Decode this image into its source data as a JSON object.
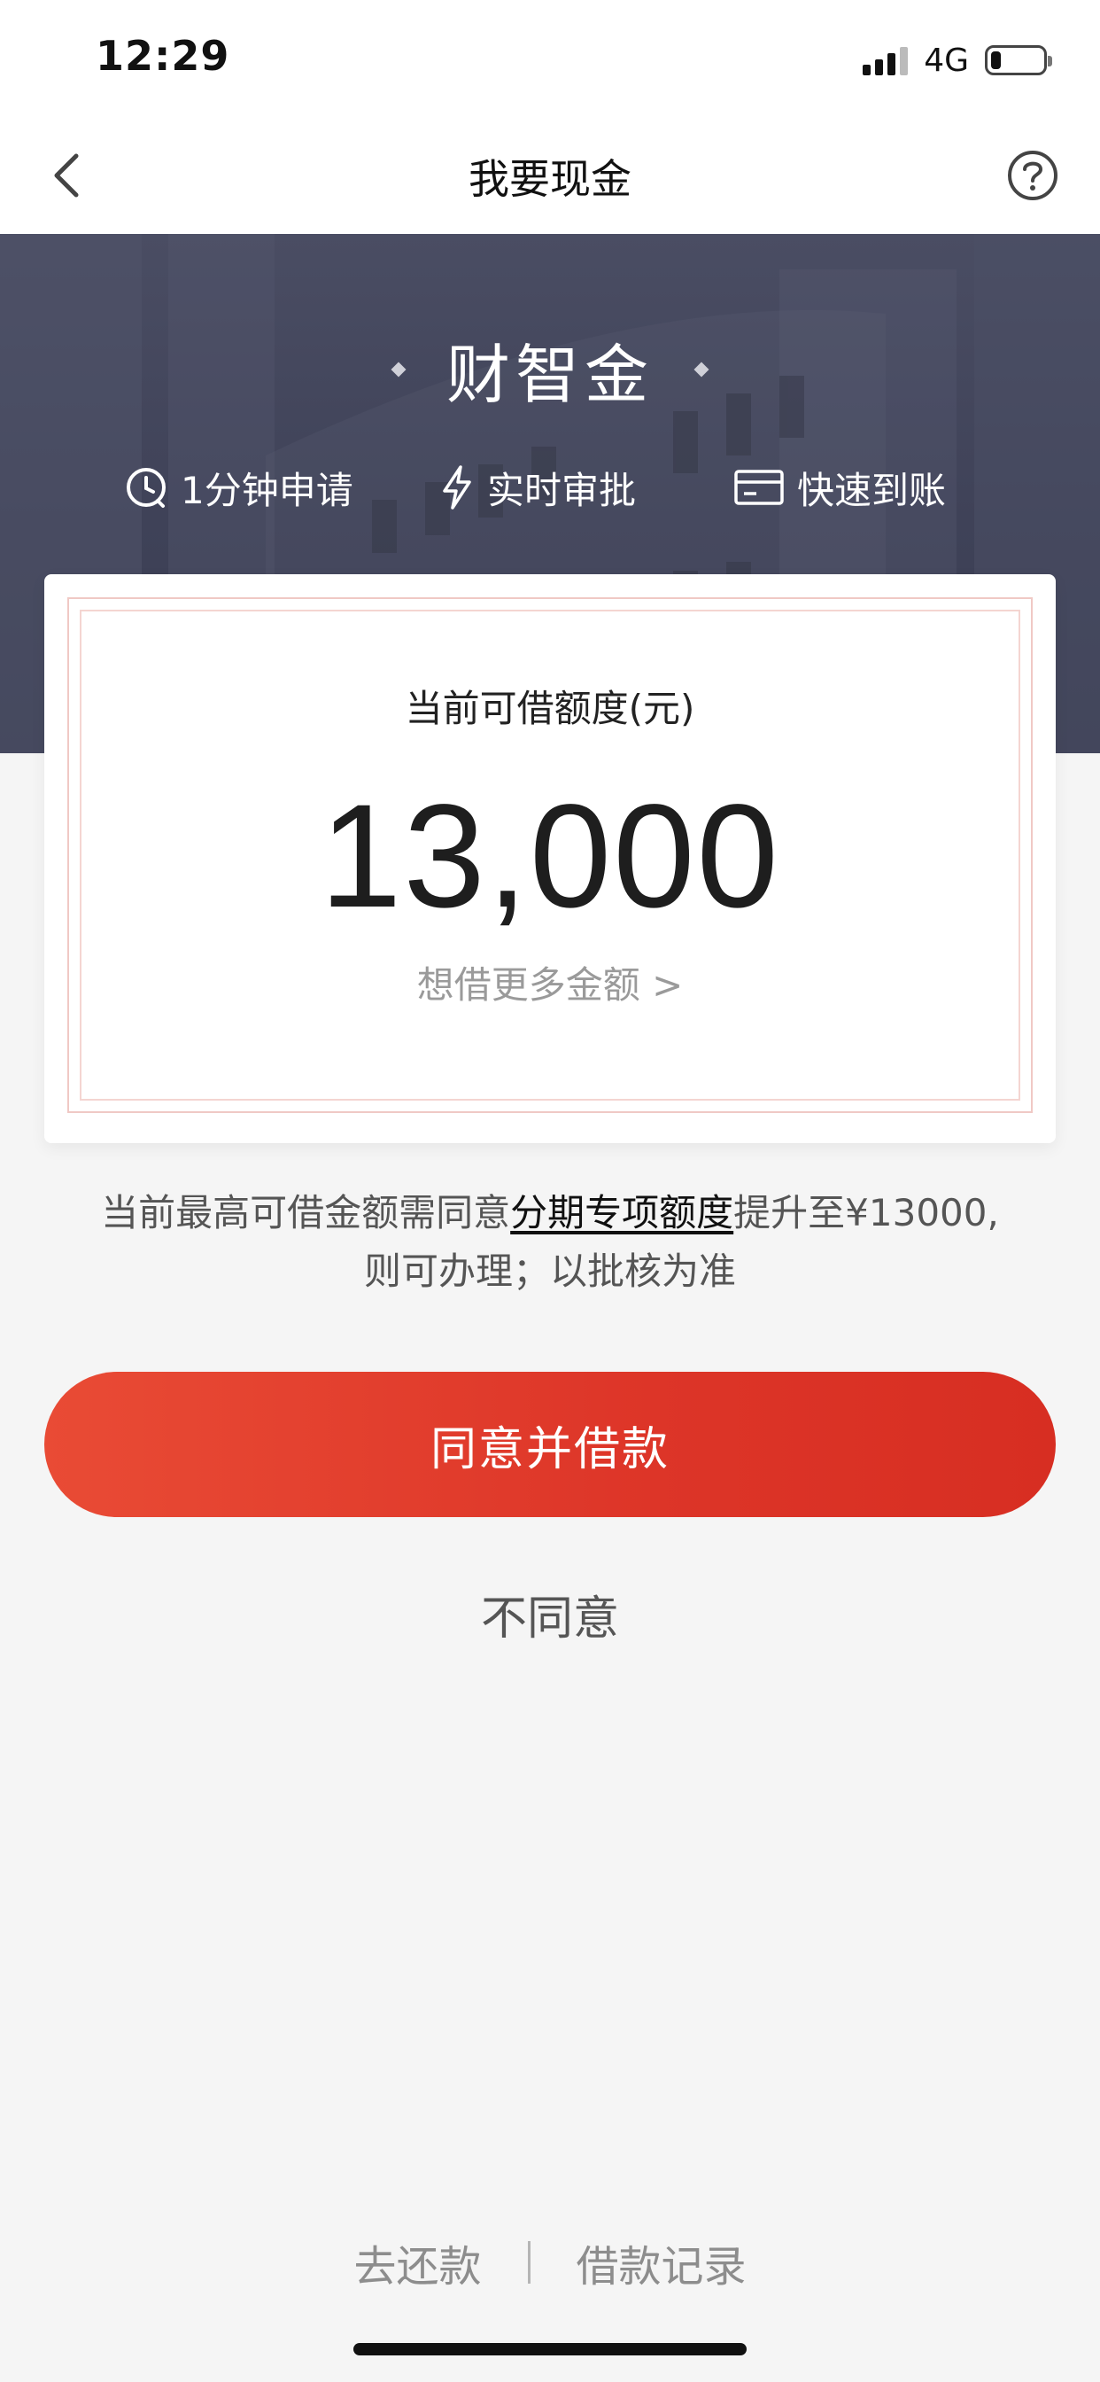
{
  "status_bar": {
    "time": "12:29",
    "network": "4G",
    "battery_level": 0.2
  },
  "nav": {
    "title": "我要现金",
    "back_icon": "chevron-left-icon",
    "help_icon": "question-circle-icon"
  },
  "hero": {
    "brand": "财智金",
    "features": [
      {
        "icon": "clock-icon",
        "label": "1分钟申请"
      },
      {
        "icon": "lightning-icon",
        "label": "实时审批"
      },
      {
        "icon": "card-icon",
        "label": "快速到账"
      }
    ]
  },
  "credit": {
    "label": "当前可借额度(元)",
    "amount": "13,000",
    "more_link": "想借更多金额 >"
  },
  "notice": {
    "before": "当前最高可借金额需同意",
    "link": "分期专项额度",
    "after_line1": "提升至¥13000,",
    "line2": "则可办理；以批核为准"
  },
  "actions": {
    "agree": "同意并借款",
    "disagree": "不同意"
  },
  "footer": {
    "repay": "去还款",
    "records": "借款记录"
  },
  "colors": {
    "accent_red": "#dd3528",
    "hero_bg": "#44475c"
  }
}
